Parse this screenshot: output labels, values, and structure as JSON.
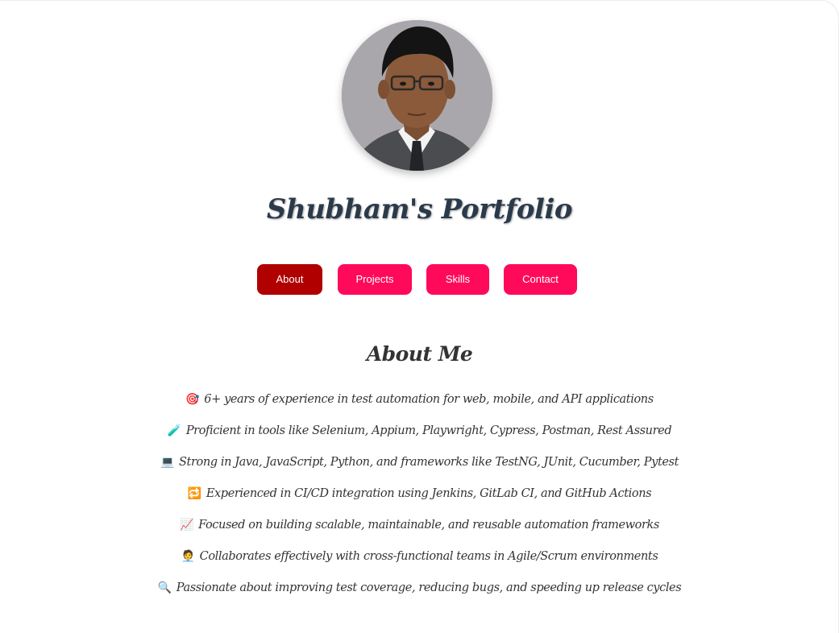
{
  "profile": {
    "title": "Shubham's Portfolio"
  },
  "nav": {
    "items": [
      {
        "label": "About",
        "active": true
      },
      {
        "label": "Projects",
        "active": false
      },
      {
        "label": "Skills",
        "active": false
      },
      {
        "label": "Contact",
        "active": false
      }
    ]
  },
  "about": {
    "heading": "About Me",
    "items": [
      {
        "icon": "🎯",
        "text": "6+ years of experience in test automation for web, mobile, and API applications"
      },
      {
        "icon": "🧪",
        "text": "Proficient in tools like Selenium, Appium, Playwright, Cypress, Postman, Rest Assured"
      },
      {
        "icon": "💻",
        "text": "Strong in Java, JavaScript, Python, and frameworks like TestNG, JUnit, Cucumber, Pytest"
      },
      {
        "icon": "🔁",
        "text": "Experienced in CI/CD integration using Jenkins, GitLab CI, and GitHub Actions"
      },
      {
        "icon": "📈",
        "text": "Focused on building scalable, maintainable, and reusable automation frameworks"
      },
      {
        "icon": "🧑‍💼",
        "text": "Collaborates effectively with cross-functional teams in Agile/Scrum environments"
      },
      {
        "icon": "🔍",
        "text": "Passionate about improving test coverage, reducing bugs, and speeding up release cycles"
      }
    ]
  },
  "colors": {
    "nav_button": "#ff0a5a",
    "nav_button_active": "#b00000",
    "title": "#2b3a4a",
    "text": "#333333"
  }
}
